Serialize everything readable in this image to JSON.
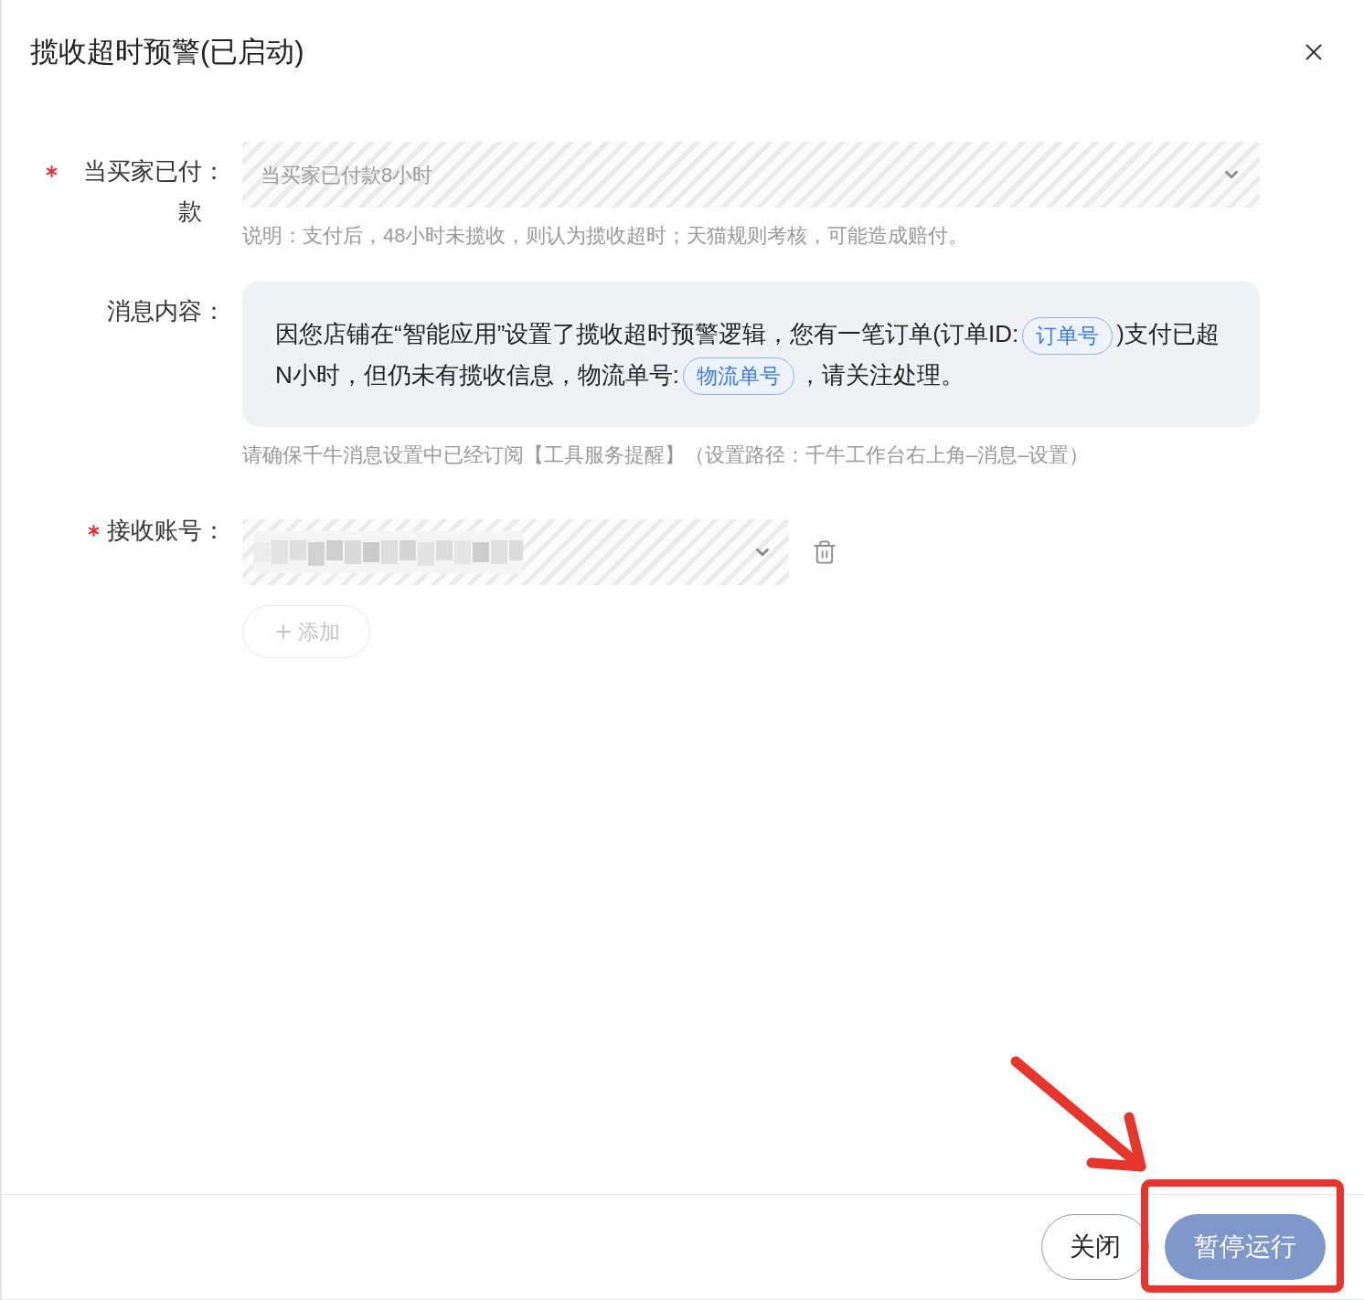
{
  "dialog": {
    "title": "揽收超时预警(已启动)"
  },
  "form": {
    "fields": [
      {
        "kind": "select",
        "required": true,
        "label": "当买家已付款",
        "colon": "：",
        "value": "当买家已付款8小时",
        "disabled": true,
        "help": "说明：支付后，48小时未揽收，则认为揽收超时；天猫规则考核，可能造成赔付。"
      },
      {
        "kind": "message",
        "required": false,
        "label": "消息内容",
        "colon": "：",
        "segments": [
          {
            "kind": "text",
            "text": "因您店铺在“智能应用”设置了揽收超时预警逻辑，您有一笔订单(订单ID:"
          },
          {
            "kind": "tag",
            "text": "订单号"
          },
          {
            "kind": "text",
            "text": ")支付已超N小时，但仍未有揽收信息，物流单号:"
          },
          {
            "kind": "tag",
            "text": "物流单号"
          },
          {
            "kind": "text",
            "text": "，请关注处理。"
          }
        ],
        "help": "请确保千牛消息设置中已经订阅【工具服务提醒】（设置路径：千牛工作台右上角–消息–设置）"
      },
      {
        "kind": "account",
        "required": true,
        "label": "接收账号",
        "colon": "：",
        "masked": true,
        "disabled": true
      }
    ],
    "add_button": {
      "label": "添加",
      "disabled": true
    }
  },
  "footer": {
    "buttons": [
      {
        "kind": "default",
        "label": "关闭",
        "highlighted": false
      },
      {
        "kind": "primary",
        "label": "暂停运行",
        "highlighted": true
      }
    ]
  }
}
